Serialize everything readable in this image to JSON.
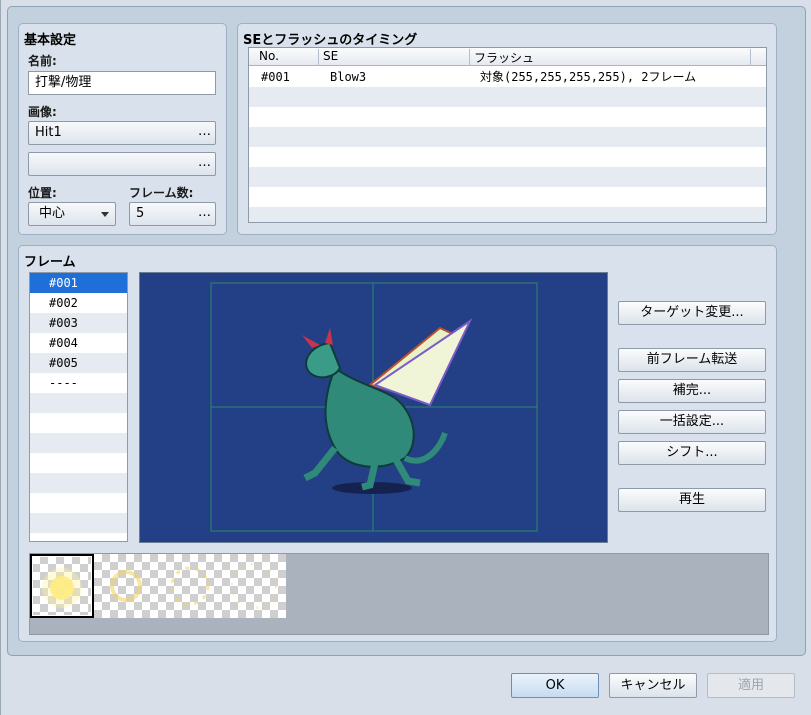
{
  "basic": {
    "title": "基本設定",
    "name_label": "名前:",
    "name_value": "打撃/物理",
    "image_label": "画像:",
    "image1_value": "Hit1",
    "image2_value": "",
    "browse_glyph": "…",
    "position_label": "位置:",
    "position_value": "中心",
    "frames_label": "フレーム数:",
    "frames_value": "5"
  },
  "se_flash": {
    "title": "SEとフラッシュのタイミング",
    "columns": [
      "No.",
      "SE",
      "フラッシュ"
    ],
    "rows": [
      {
        "no": "#001",
        "se": "Blow3",
        "flash": "対象(255,255,255,255), 2フレーム"
      }
    ]
  },
  "frames": {
    "title": "フレーム",
    "items": [
      "#001",
      "#002",
      "#003",
      "#004",
      "#005",
      "----"
    ],
    "selected": "#001"
  },
  "side_buttons": {
    "target": "ターゲット変更...",
    "prev_transfer": "前フレーム転送",
    "interpolate": "補完...",
    "batch": "一括設定...",
    "shift": "シフト...",
    "play": "再生"
  },
  "dialog": {
    "ok": "OK",
    "cancel": "キャンセル",
    "apply": "適用"
  },
  "colors": {
    "canvas_bg": "#233f86",
    "selection": "#1e6fd8",
    "guide_lines": "#2e8a6a"
  }
}
